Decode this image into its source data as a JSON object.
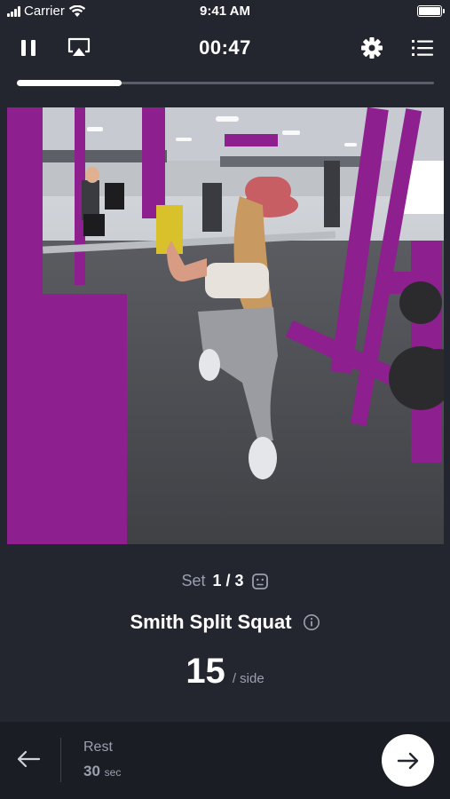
{
  "status_bar": {
    "carrier": "Carrier",
    "time": "9:41 AM"
  },
  "toolbar": {
    "timer": "00:47",
    "pause_icon": "pause-icon",
    "airplay_icon": "airplay-icon",
    "settings_icon": "gear-icon",
    "list_icon": "list-icon"
  },
  "workout_progress": 0.25,
  "video": {
    "description_icon": "exercise-video"
  },
  "exercise": {
    "set_label": "Set",
    "set_count": "1 / 3",
    "name": "Smith Split Squat",
    "reps": "15",
    "reps_unit": "/ side"
  },
  "bottom_bar": {
    "rest_label": "Rest",
    "rest_value": "30",
    "rest_unit": "sec"
  },
  "colors": {
    "background": "#23252f",
    "bottom_bar": "#1b1d25",
    "muted_text": "#9aa0ad",
    "accent_purple": "#8a1e8c"
  }
}
